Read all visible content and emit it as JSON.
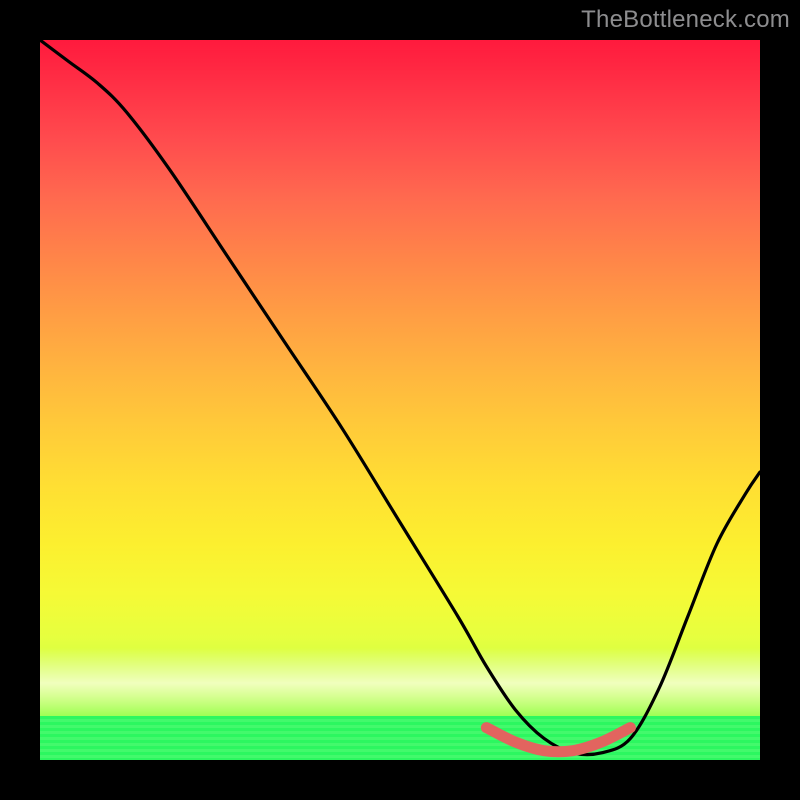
{
  "watermark": "TheBottleneck.com",
  "colors": {
    "frame": "#000000",
    "curve_stroke": "#000000",
    "trough_stroke": "#e2645f",
    "gradient_top": "#ff1a3d",
    "gradient_bottom": "#3ffb62"
  },
  "chart_data": {
    "type": "line",
    "title": "",
    "xlabel": "",
    "ylabel": "",
    "xlim": [
      0,
      100
    ],
    "ylim": [
      0,
      100
    ],
    "note": "Axes are unlabeled; x/y values are estimated as 0–100 percentages of the plot area, y=0 at bottom. Background color encodes y (red high → green low).",
    "series": [
      {
        "name": "bottleneck-curve",
        "x": [
          0,
          4,
          8,
          12,
          18,
          26,
          34,
          42,
          50,
          58,
          62,
          66,
          70,
          74,
          78,
          82,
          86,
          90,
          94,
          98,
          100
        ],
        "y": [
          100,
          97,
          94,
          90,
          82,
          70,
          58,
          46,
          33,
          20,
          13,
          7,
          3,
          1,
          1,
          3,
          10,
          20,
          30,
          37,
          40
        ]
      }
    ],
    "trough_segment": {
      "name": "optimal-range-highlight",
      "x": [
        62,
        66,
        70,
        74,
        78,
        82
      ],
      "y": [
        4.5,
        2.5,
        1.3,
        1.3,
        2.5,
        4.5
      ]
    }
  }
}
